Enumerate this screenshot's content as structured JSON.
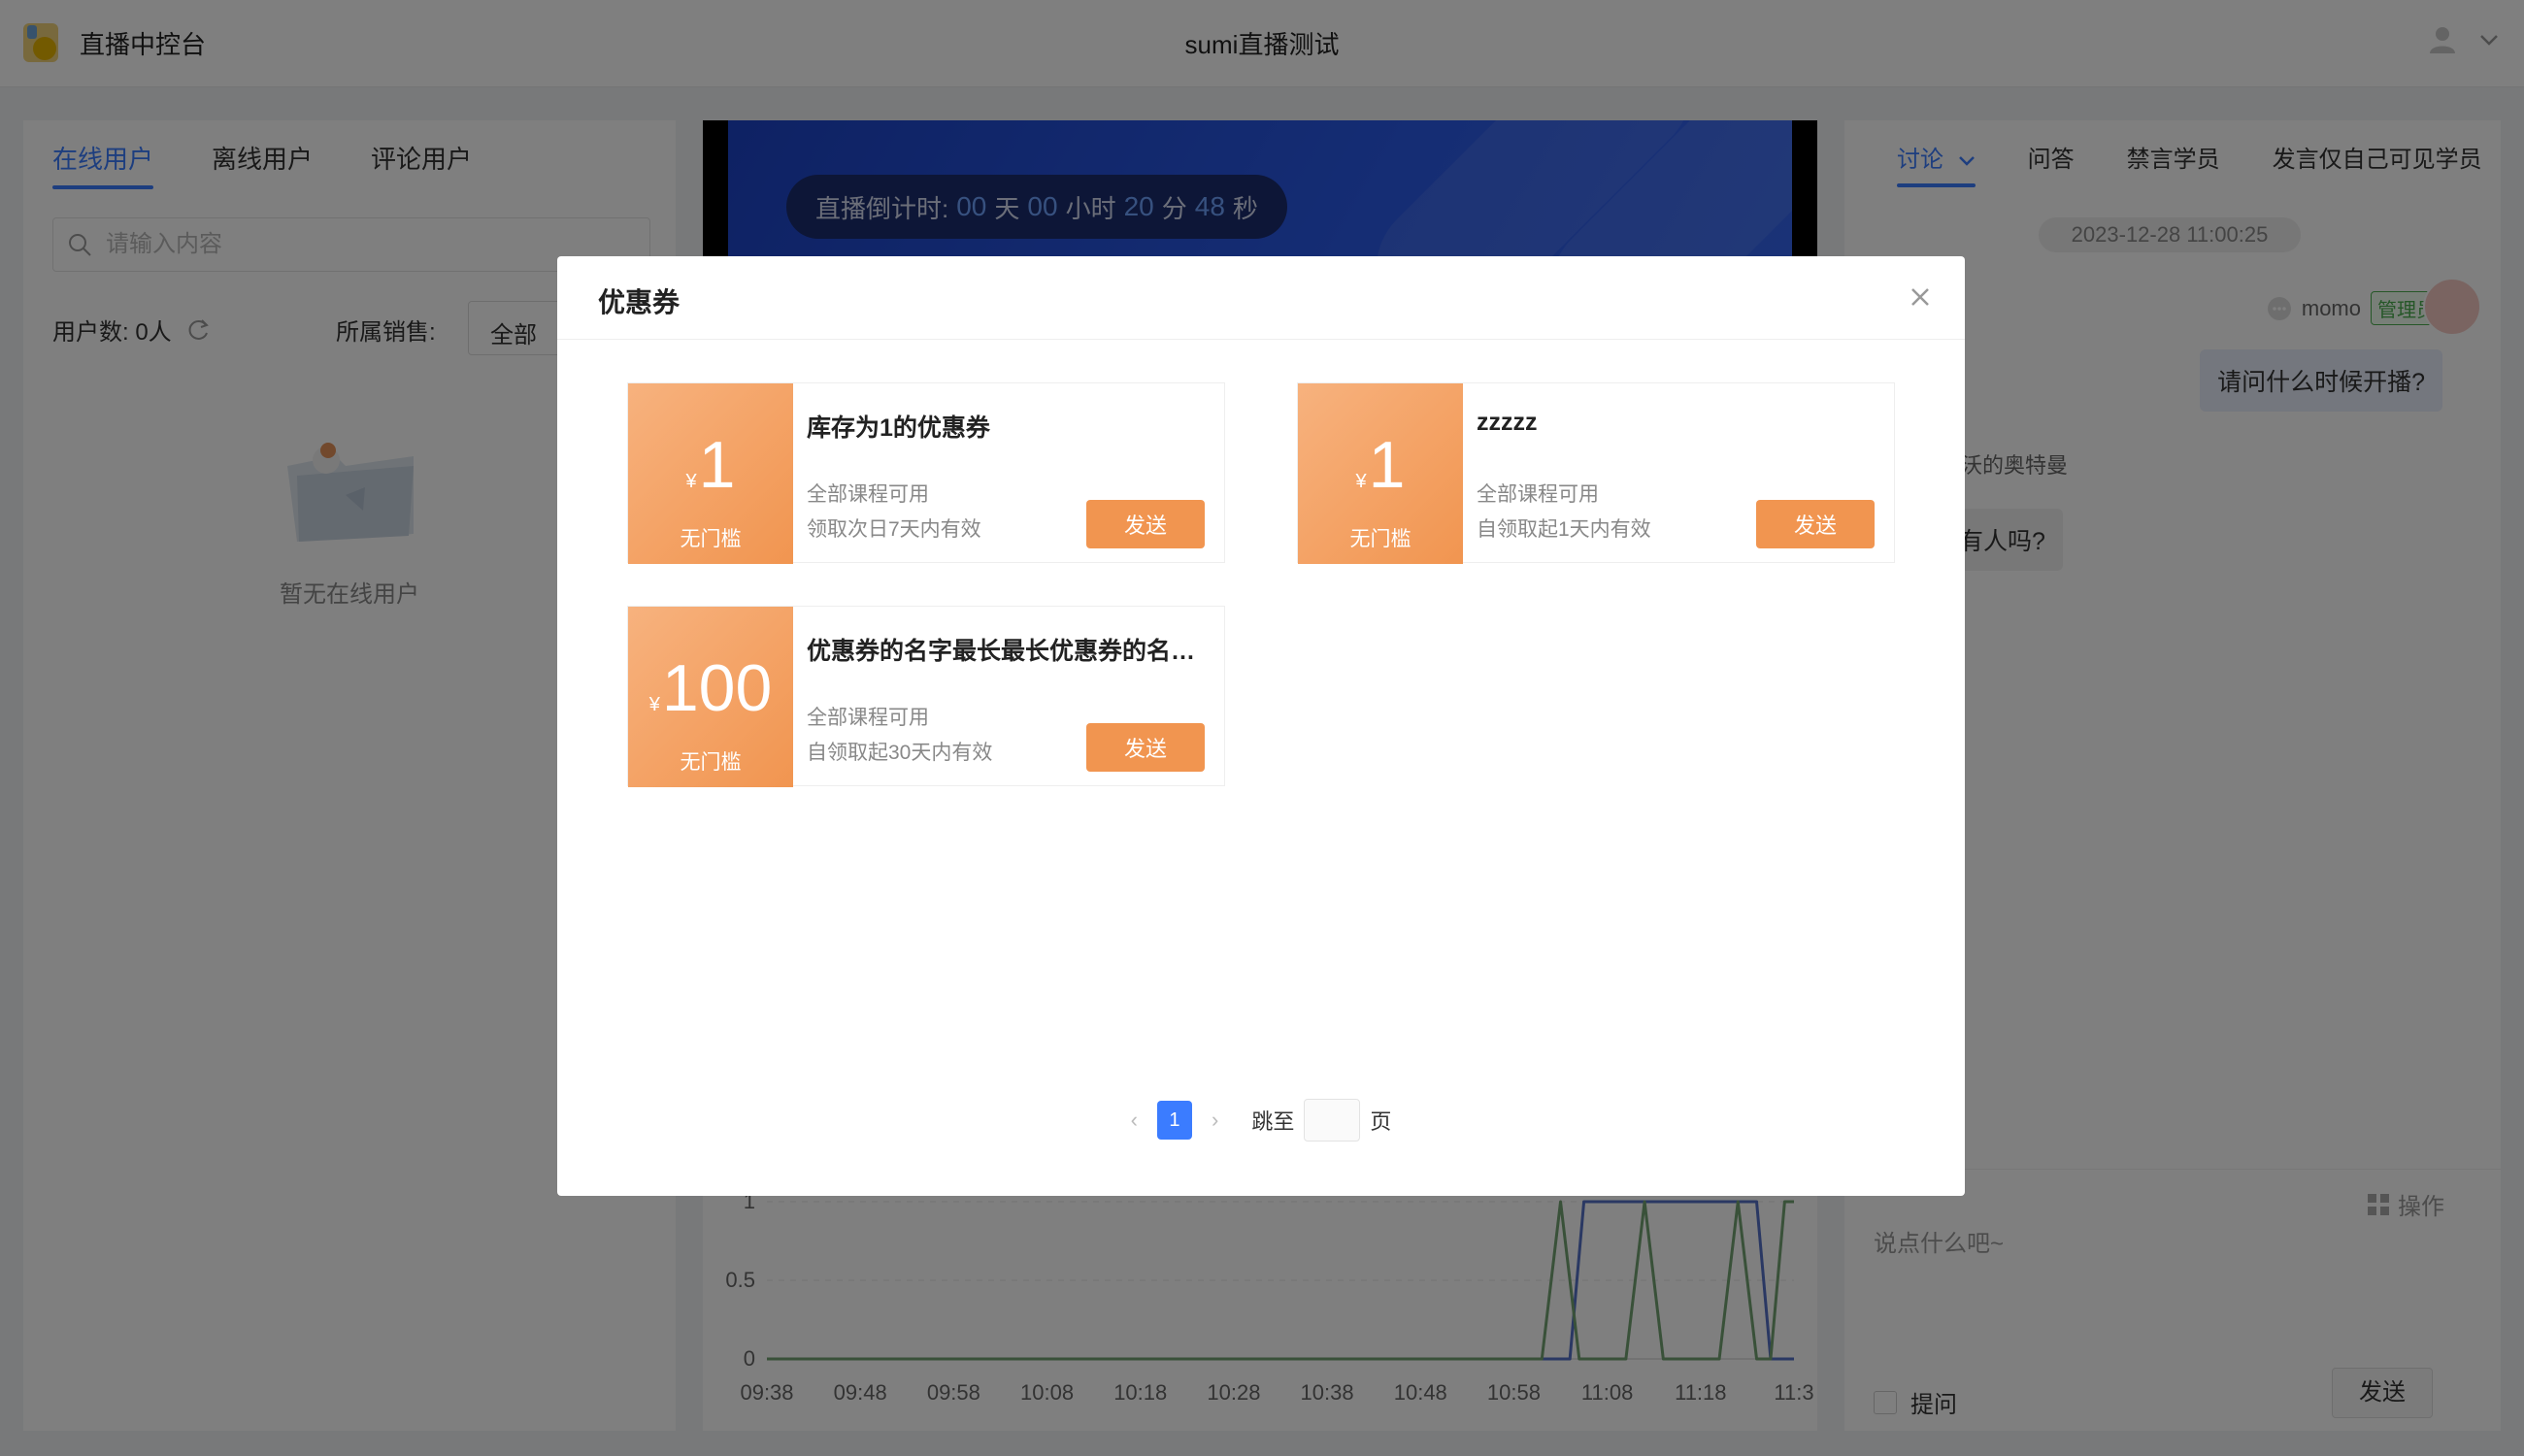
{
  "header": {
    "app_title": "直播中控台",
    "live_title": "sumi直播测试"
  },
  "left": {
    "tabs": [
      {
        "label": "在线用户"
      },
      {
        "label": "离线用户"
      },
      {
        "label": "评论用户"
      }
    ],
    "search_placeholder": "请输入内容",
    "user_count": "用户数: 0人",
    "sales_label": "所属销售:",
    "sales_value": "全部",
    "empty_text": "暂无在线用户"
  },
  "center": {
    "countdown_prefix": "直播倒计时:",
    "days": "00",
    "days_unit": "天",
    "hours": "00",
    "hours_unit": "小时",
    "minutes": "20",
    "minutes_unit": "分",
    "seconds": "48",
    "seconds_unit": "秒"
  },
  "chart_data": {
    "type": "line",
    "title": "",
    "xlabel": "",
    "ylabel": "",
    "ylim": [
      0,
      1
    ],
    "y_ticks": [
      "0",
      "0.5",
      "1"
    ],
    "x": [
      "09:38",
      "09:48",
      "09:58",
      "10:08",
      "10:18",
      "10:28",
      "10:38",
      "10:48",
      "10:58",
      "11:08",
      "11:18",
      "11:3"
    ],
    "series": [
      {
        "color": "#5470c6",
        "points": [
          [
            0,
            0
          ],
          [
            8.6,
            0
          ],
          [
            8.75,
            1
          ],
          [
            9.6,
            1
          ],
          [
            9.75,
            1
          ],
          [
            10.6,
            1
          ],
          [
            10.75,
            0
          ],
          [
            11,
            0
          ]
        ]
      },
      {
        "color": "#73a373",
        "points": [
          [
            0,
            0
          ],
          [
            8.3,
            0
          ],
          [
            8.5,
            1
          ],
          [
            8.7,
            0
          ],
          [
            9.2,
            0
          ],
          [
            9.4,
            1
          ],
          [
            9.6,
            0
          ],
          [
            10.2,
            0
          ],
          [
            10.4,
            1
          ],
          [
            10.6,
            0
          ],
          [
            10.75,
            0
          ],
          [
            10.9,
            1
          ],
          [
            11,
            1
          ]
        ]
      }
    ]
  },
  "right": {
    "tabs": [
      {
        "label": "讨论"
      },
      {
        "label": "问答"
      },
      {
        "label": "禁言学员"
      },
      {
        "label": "发言仅自己可见学员"
      }
    ],
    "chat_time": "2023-12-28 11:00:25",
    "msg1_user": "momo",
    "msg1_tag": "管理员",
    "msg1_text": "请问什么时候开播?",
    "msg2_user": "沃的奥特曼",
    "msg2_text": "有人吗?",
    "ops_label": "操作",
    "input_placeholder": "说点什么吧~",
    "ask_label": "提问",
    "send_label": "发送"
  },
  "modal": {
    "title": "优惠券",
    "coupons": [
      {
        "currency": "¥",
        "amount": "1",
        "condition": "无门槛",
        "name": "库存为1的优惠券",
        "scope": "全部课程可用",
        "validity": "领取次日7天内有效",
        "send": "发送"
      },
      {
        "currency": "¥",
        "amount": "1",
        "condition": "无门槛",
        "name": "zzzzz",
        "scope": "全部课程可用",
        "validity": "自领取起1天内有效",
        "send": "发送"
      },
      {
        "currency": "¥",
        "amount": "100",
        "condition": "无门槛",
        "name": "优惠券的名字最长最长优惠券的名字最长最长",
        "scope": "全部课程可用",
        "validity": "自领取起30天内有效",
        "send": "发送"
      }
    ],
    "pagination": {
      "current": "1",
      "jump_label": "跳至",
      "page_label": "页"
    }
  },
  "colors": {
    "accent": "#3b7cff",
    "coupon_orange": "#f19550",
    "admin_green": "#4caf50"
  }
}
